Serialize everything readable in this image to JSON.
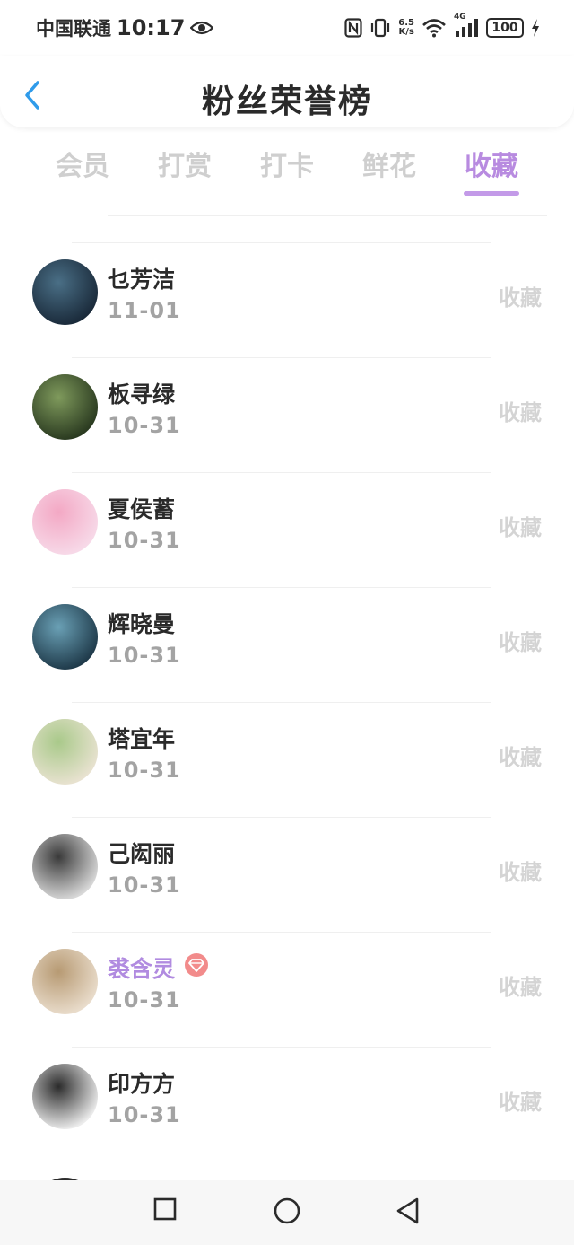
{
  "status": {
    "carrier": "中国联通",
    "time": "10:17",
    "net_speed_value": "6.5",
    "net_speed_unit": "K/s",
    "signal_type": "4G",
    "battery": "100"
  },
  "header": {
    "title": "粉丝荣誉榜"
  },
  "tabs": [
    {
      "label": "会员"
    },
    {
      "label": "打赏"
    },
    {
      "label": "打卡"
    },
    {
      "label": "鲜花"
    },
    {
      "label": "收藏",
      "active": true
    }
  ],
  "fans": [
    {
      "name": "乜芳洁",
      "date": "11-01",
      "action": "收藏",
      "avatar_colors": [
        "#1a2a3a",
        "#4a6f86"
      ]
    },
    {
      "name": "板寻绿",
      "date": "10-31",
      "action": "收藏",
      "avatar_colors": [
        "#2a3a20",
        "#7f9a5c"
      ]
    },
    {
      "name": "夏侯蓄",
      "date": "10-31",
      "action": "收藏",
      "avatar_colors": [
        "#f7d9e8",
        "#f3a8c4"
      ]
    },
    {
      "name": "辉晓曼",
      "date": "10-31",
      "action": "收藏",
      "avatar_colors": [
        "#1f3a4a",
        "#6aa0b5"
      ]
    },
    {
      "name": "塔宜年",
      "date": "10-31",
      "action": "收藏",
      "avatar_colors": [
        "#e8e2d0",
        "#a9c98a"
      ]
    },
    {
      "name": "己闳丽",
      "date": "10-31",
      "action": "收藏",
      "avatar_colors": [
        "#d8d8d8",
        "#3a3a3a"
      ]
    },
    {
      "name": "裘含灵",
      "date": "10-31",
      "action": "收藏",
      "vip": true,
      "avatar_colors": [
        "#e9dccb",
        "#b79a73"
      ]
    },
    {
      "name": "印方方",
      "date": "10-31",
      "action": "收藏",
      "avatar_colors": [
        "#ececec",
        "#2b2b2b"
      ]
    }
  ],
  "colors": {
    "accent": "#b88be0",
    "tab_inactive": "#cfcfcf",
    "date_text": "#a3a3a3",
    "action_text": "#d4d4d4",
    "vip_badge": "#f28b8b"
  }
}
